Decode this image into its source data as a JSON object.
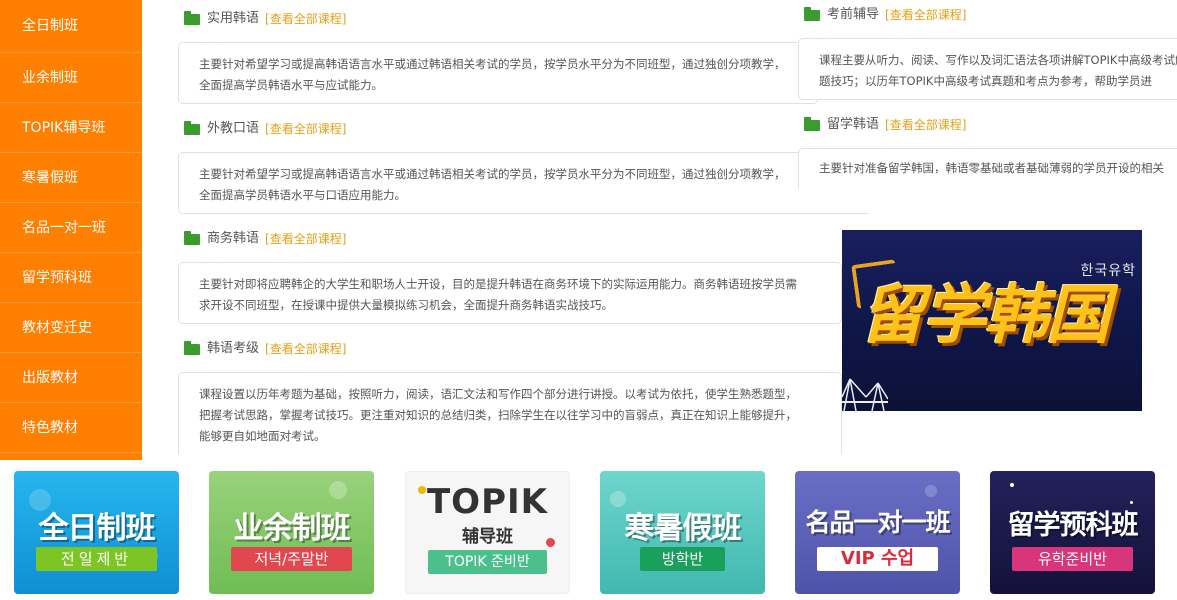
{
  "sidebar": {
    "items": [
      {
        "label": "全日制班"
      },
      {
        "label": "业余制班"
      },
      {
        "label": "TOPIK辅导班"
      },
      {
        "label": "寒暑假班"
      },
      {
        "label": "名品一对一班"
      },
      {
        "label": "留学预科班"
      },
      {
        "label": "教材变迁史"
      },
      {
        "label": "出版教材"
      },
      {
        "label": "特色教材"
      }
    ]
  },
  "view_all_label": "查看全部课程",
  "bracket_open": "[",
  "bracket_close": "]",
  "courses": [
    {
      "title": "实用韩语",
      "desc": "主要针对希望学习或提高韩语语言水平或通过韩语相关考试的学员，按学员水平分为不同班型，通过独创分项教学，全面提高学员韩语水平与应试能力。"
    },
    {
      "title": "外教口语",
      "desc": "主要针对希望学习或提高韩语语言水平或通过韩语相关考试的学员，按学员水平分为不同班型，通过独创分项教学，全面提高学员韩语水平与口语应用能力。"
    },
    {
      "title": "商务韩语",
      "desc": "主要针对即将应聘韩企的大学生和职场人士开设，目的是提升韩语在商务环境下的实际运用能力。商务韩语班按学员需求开设不同班型，在授课中提供大量模拟练习机会，全面提升商务韩语实战技巧。"
    },
    {
      "title": "韩语考级",
      "desc": "课程设置以历年考题为基础，按照听力，阅读，语汇文法和写作四个部分进行讲授。以考试为依托，使学生熟悉题型，把握考试思路，掌握考试技巧。更注重对知识的总结归类，扫除学生在以往学习中的盲弱点，真正在知识上能够提升，能够更自如地面对考试。"
    },
    {
      "title": "考前辅导",
      "desc": "课程主要从听力、阅读、写作以及词汇语法各项讲解TOPIK中高级考试解题技巧；以历年TOPIK中高级考试真题和考点为参考，帮助学员进"
    },
    {
      "title": "留学韩语",
      "desc": "主要针对准备留学韩国，韩语零基础或者基础薄弱的学员开设的相关"
    }
  ],
  "banner": {
    "small_text": "한국유학",
    "title": "留学韩国"
  },
  "tiles": [
    {
      "main": "全日制班",
      "sub": "전일제반",
      "color": "#19a7e0"
    },
    {
      "main": "业余制班",
      "sub": "저녁/주말반",
      "color": "#7bc35b"
    },
    {
      "main": "TOPIK",
      "main2": "辅导班",
      "sub": "TOPIK 준비반",
      "color": "#f4f4f4"
    },
    {
      "main": "寒暑假班",
      "sub": "방학반",
      "color": "#4bc3ba"
    },
    {
      "main": "名品一对一班",
      "sub": "VIP 수업",
      "color": "#5b5fb7"
    },
    {
      "main": "留学预科班",
      "sub": "유학준비반",
      "color": "#1d1b4a"
    }
  ]
}
